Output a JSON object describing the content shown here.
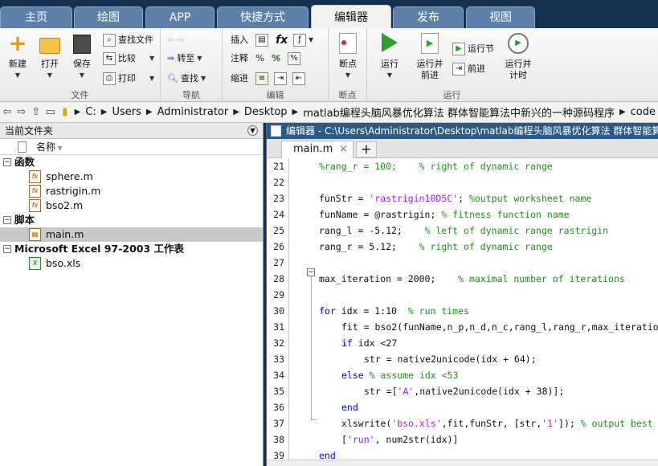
{
  "tabs": [
    "主页",
    "绘图",
    "APP",
    "快捷方式",
    "编辑器",
    "发布",
    "视图"
  ],
  "ribbon": {
    "file": {
      "new": "新建",
      "open": "打开",
      "save": "保存",
      "find_files": "查找文件",
      "compare": "比较",
      "print": "打印",
      "label": "文件"
    },
    "nav": {
      "goto": "转至",
      "find": "查找",
      "label": "导航"
    },
    "edit": {
      "insert": "插入",
      "comment": "注释",
      "indent": "缩进",
      "fx": "fx",
      "label": "编辑"
    },
    "bp": {
      "breakpoints": "断点",
      "label": "断点"
    },
    "run": {
      "run": "运行",
      "run_advance_l1": "运行并",
      "run_advance_l2": "前进",
      "run_section": "运行节",
      "advance": "前进",
      "run_time_l1": "运行并",
      "run_time_l2": "计时",
      "label": "运行"
    }
  },
  "address": {
    "crumbs": [
      "C:",
      "Users",
      "Administrator",
      "Desktop",
      "matlab编程头脑风暴优化算法 群体智能算法中新兴的一种源码程序",
      "code"
    ]
  },
  "left": {
    "title": "当前文件夹",
    "col_name": "名称",
    "groups": [
      {
        "label": "函数",
        "files": [
          "sphere.m",
          "rastrigin.m",
          "bso2.m"
        ]
      },
      {
        "label": "脚本",
        "files": [
          "main.m"
        ]
      },
      {
        "label": "Microsoft Excel 97-2003 工作表",
        "files": [
          "bso.xls"
        ]
      }
    ]
  },
  "editor": {
    "title": "编辑器 - C:\\Users\\Administrator\\Desktop\\matlab编程头脑风暴优化算法 群体智能算",
    "tab": "main.m",
    "plus": "+",
    "lines": [
      {
        "n": "21",
        "t": "%rang_r = 100;    % right of dynamic range"
      },
      {
        "n": "22",
        "t": ""
      },
      {
        "n": "23",
        "t": "funStr = 'rastrigin10D5C'; %output worksheet name"
      },
      {
        "n": "24",
        "t": "funName = @rastrigin; % fitness function name"
      },
      {
        "n": "25",
        "t": "rang_l = -5.12;    % left of dynamic range rastrigin"
      },
      {
        "n": "26",
        "t": "rang_r = 5.12;    % right of dynamic range"
      },
      {
        "n": "27",
        "t": ""
      },
      {
        "n": "28",
        "t": "max_iteration = 2000;    % maximal number of iterations"
      },
      {
        "n": "29",
        "t": ""
      },
      {
        "n": "30",
        "t": "for idx = 1:10  % run times"
      },
      {
        "n": "31",
        "t": "fit = bso2(funName,n_p,n_d,n_c,rang_l,rang_r,max_iteration"
      },
      {
        "n": "32",
        "t": "if idx <27"
      },
      {
        "n": "33",
        "t": "str = native2unicode(idx + 64);"
      },
      {
        "n": "34",
        "t": "else % assume idx <53"
      },
      {
        "n": "35",
        "t": "str =['A',native2unicode(idx + 38)];"
      },
      {
        "n": "36",
        "t": "end"
      },
      {
        "n": "37",
        "t": "xlswrite('bso.xls',fit,funStr, [str,'1']); % output best"
      },
      {
        "n": "38",
        "t": "['run', num2str(idx)]"
      },
      {
        "n": "39",
        "t": "end"
      }
    ]
  }
}
